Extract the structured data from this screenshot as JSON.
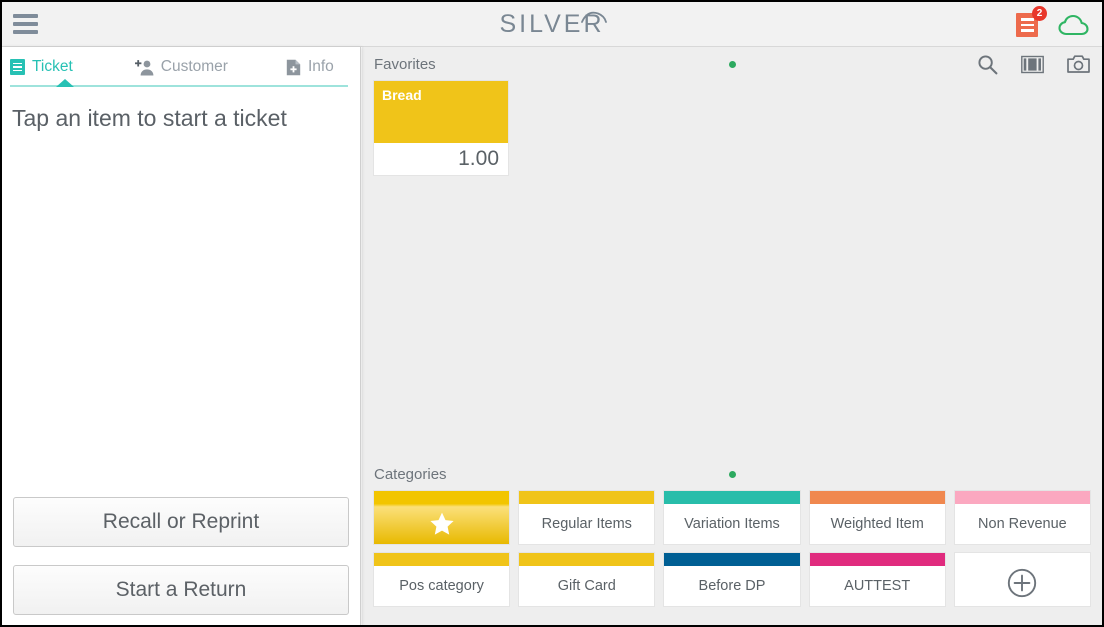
{
  "header": {
    "menu_icon": "hamburger-icon",
    "logo_text": "SILVER",
    "receipt_icon": "receipt-icon",
    "receipt_badge_count": "2",
    "cloud_icon": "cloud-icon",
    "colors": {
      "receipt": "#ed6a4c",
      "badge": "#e8372b",
      "cloud": "#2fb563",
      "logo": "#7a8793"
    }
  },
  "left_panel": {
    "tabs": [
      {
        "label": "Ticket",
        "icon": "ticket-icon",
        "active": true
      },
      {
        "label": "Customer",
        "icon": "add-customer-icon",
        "active": false
      },
      {
        "label": "Info",
        "icon": "info-document-icon",
        "active": false
      }
    ],
    "hint": "Tap an item to start a ticket",
    "buttons": [
      {
        "label": "Recall or Reprint"
      },
      {
        "label": "Start a Return"
      }
    ],
    "accent_color": "#27c1b4"
  },
  "favorites": {
    "title": "Favorites",
    "page_dot_color": "#2ca95f",
    "tools": [
      {
        "name": "search-icon"
      },
      {
        "name": "barcode-icon"
      },
      {
        "name": "camera-icon"
      }
    ],
    "items": [
      {
        "name": "Bread",
        "price": "1.00",
        "color": "#f0c419"
      }
    ]
  },
  "categories": {
    "title": "Categories",
    "page_dot_color": "#2ca95f",
    "tiles": [
      {
        "label": "",
        "icon": "star-icon",
        "color": "#f2c500",
        "selected": true
      },
      {
        "label": "Regular Items",
        "color": "#f0c419",
        "selected": false
      },
      {
        "label": "Variation Items",
        "color": "#28bdaa",
        "selected": false
      },
      {
        "label": "Weighted Item",
        "color": "#f0884f",
        "selected": false
      },
      {
        "label": "Non Revenue",
        "color": "#fba8c0",
        "selected": false
      },
      {
        "label": "Pos category",
        "color": "#f0c419",
        "selected": false
      },
      {
        "label": "Gift Card",
        "color": "#f0c419",
        "selected": false
      },
      {
        "label": "Before DP",
        "color": "#005f94",
        "selected": false
      },
      {
        "label": "AUTTEST",
        "color": "#e02b7e",
        "selected": false
      },
      {
        "label": "",
        "icon": "add-circle-icon",
        "color": "transparent",
        "selected": false,
        "add_new": true
      }
    ]
  }
}
